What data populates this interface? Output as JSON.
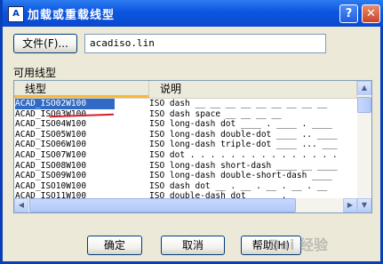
{
  "window": {
    "title": "加载或重载线型",
    "help_glyph": "?",
    "close_glyph": "✕",
    "app_icon_glyph": "A"
  },
  "file": {
    "button_label": "文件(F)...",
    "filename": "acadiso.lin"
  },
  "list": {
    "group_label": "可用线型",
    "col_linetype": "线型",
    "col_description": "说明",
    "rows": [
      {
        "name": "ACAD_ISO02W100",
        "desc": "ISO dash __ __ __ __ __ __ __ __ __",
        "selected": true
      },
      {
        "name": "ACAD_ISO03W100",
        "desc": "ISO dash space __    __    __    __"
      },
      {
        "name": "ACAD_ISO04W100",
        "desc": "ISO long-dash dot ____ . ____ . ____"
      },
      {
        "name": "ACAD_ISO05W100",
        "desc": "ISO long-dash double-dot ____ .. ____"
      },
      {
        "name": "ACAD_ISO06W100",
        "desc": "ISO long-dash triple-dot ____ ... ___"
      },
      {
        "name": "ACAD_ISO07W100",
        "desc": "ISO dot . . . . . . . . . . . . . . ."
      },
      {
        "name": "ACAD_ISO08W100",
        "desc": "ISO long-dash short-dash ____ __ ____"
      },
      {
        "name": "ACAD_ISO09W100",
        "desc": "ISO long-dash double-short-dash ____"
      },
      {
        "name": "ACAD_ISO10W100",
        "desc": "ISO dash dot __ . __ . __ . __ . __"
      },
      {
        "name": "ACAD_ISO11W100",
        "desc": "ISO double-dash dot __ __ . __ __"
      }
    ],
    "scroll_up": "▲",
    "scroll_down": "▼",
    "scroll_left": "◀",
    "scroll_right": "▶"
  },
  "buttons": {
    "ok": "确定",
    "cancel": "取消",
    "help": "帮助(H)"
  },
  "watermark": "Bai 经验",
  "colors": {
    "titlebar": "#0b55e0",
    "selection": "#316ac5",
    "annotation_red": "#d4202a",
    "header_accent": "#f6b93a"
  }
}
